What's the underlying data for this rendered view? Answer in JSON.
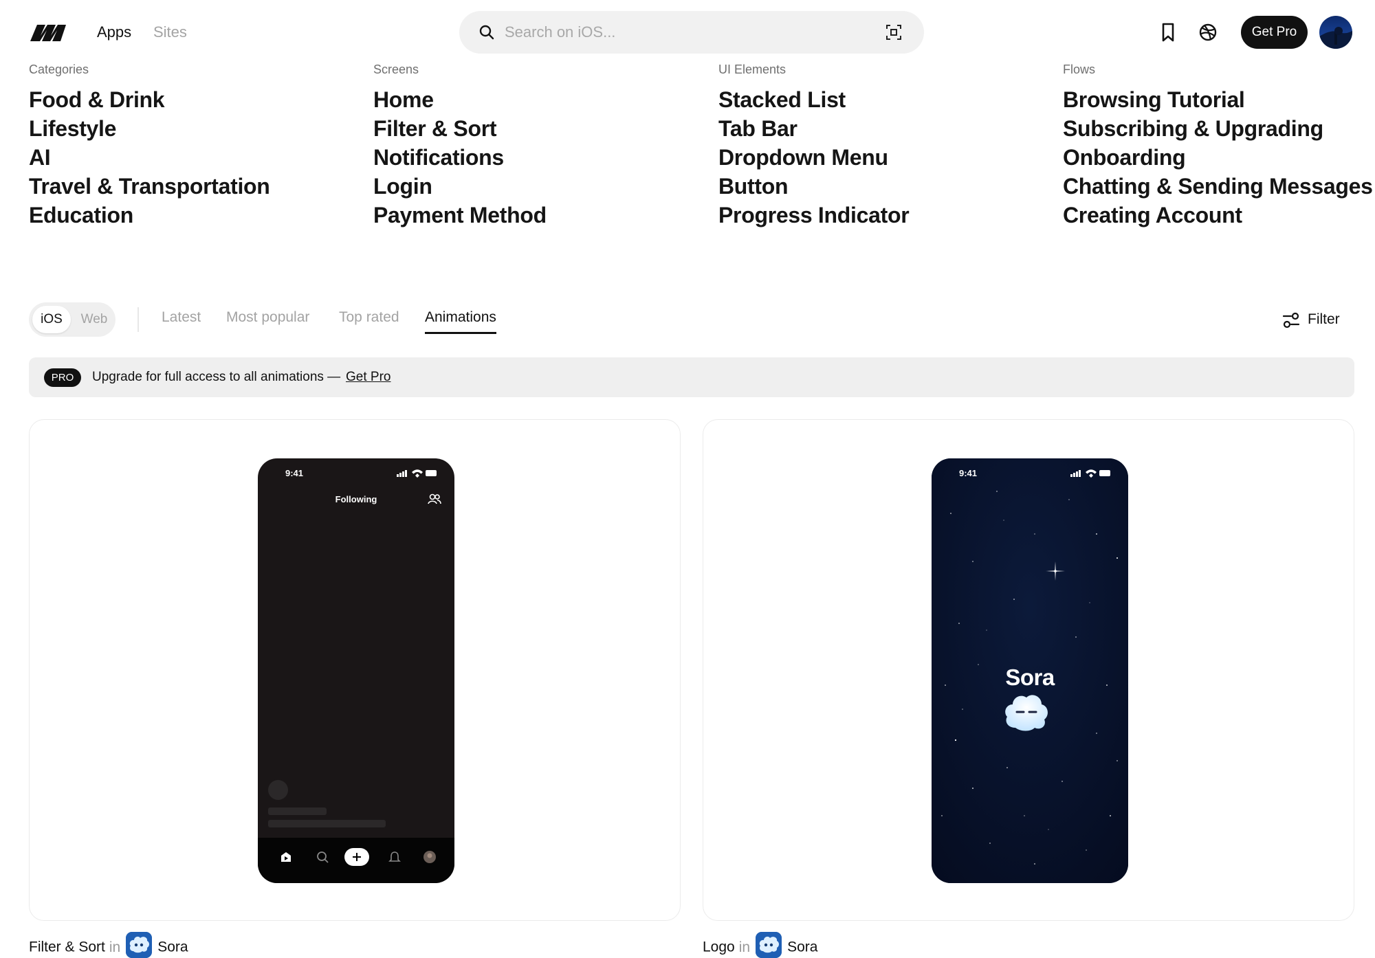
{
  "header": {
    "nav": [
      {
        "label": "Apps",
        "active": true
      },
      {
        "label": "Sites",
        "active": false
      }
    ],
    "search": {
      "placeholder": "Search on iOS...",
      "value": ""
    },
    "get_pro_label": "Get Pro",
    "icons": [
      "logo-icon",
      "search-icon",
      "scan-icon",
      "bookmark-icon",
      "dribbble-icon",
      "avatar"
    ]
  },
  "menu": [
    {
      "title": "Categories",
      "items": [
        "Food & Drink",
        "Lifestyle",
        "AI",
        "Travel & Transportation",
        "Education"
      ]
    },
    {
      "title": "Screens",
      "items": [
        "Home",
        "Filter & Sort",
        "Notifications",
        "Login",
        "Payment Method"
      ]
    },
    {
      "title": "UI Elements",
      "items": [
        "Stacked List",
        "Tab Bar",
        "Dropdown Menu",
        "Button",
        "Progress Indicator"
      ]
    },
    {
      "title": "Flows",
      "items": [
        "Browsing Tutorial",
        "Subscribing & Upgrading",
        "Onboarding",
        "Chatting & Sending Messages",
        "Creating Account"
      ]
    }
  ],
  "filters": {
    "platforms": [
      {
        "label": "iOS",
        "selected": true
      },
      {
        "label": "Web",
        "selected": false
      }
    ],
    "sort_tabs": [
      {
        "label": "Latest",
        "active": false
      },
      {
        "label": "Most popular",
        "active": false
      },
      {
        "label": "Top rated",
        "active": false
      },
      {
        "label": "Animations",
        "active": true
      }
    ],
    "filter_label": "Filter"
  },
  "pro_banner": {
    "badge": "PRO",
    "text": "Upgrade for full access to all animations —",
    "link": "Get Pro"
  },
  "cards": [
    {
      "phone": {
        "time": "9:41",
        "header_title": "Following"
      },
      "caption": {
        "screen": "Filter & Sort",
        "in": "in",
        "app": "Sora"
      }
    },
    {
      "phone": {
        "time": "9:41",
        "logo_text": "Sora"
      },
      "caption": {
        "screen": "Logo",
        "in": "in",
        "app": "Sora"
      }
    }
  ],
  "colors": {
    "accent_dark": "#111111",
    "muted_text": "#a3a3a3",
    "banner_bg": "#efefef",
    "sora_night": "#071128",
    "sora_icon_blue": "#1f5fb4"
  }
}
